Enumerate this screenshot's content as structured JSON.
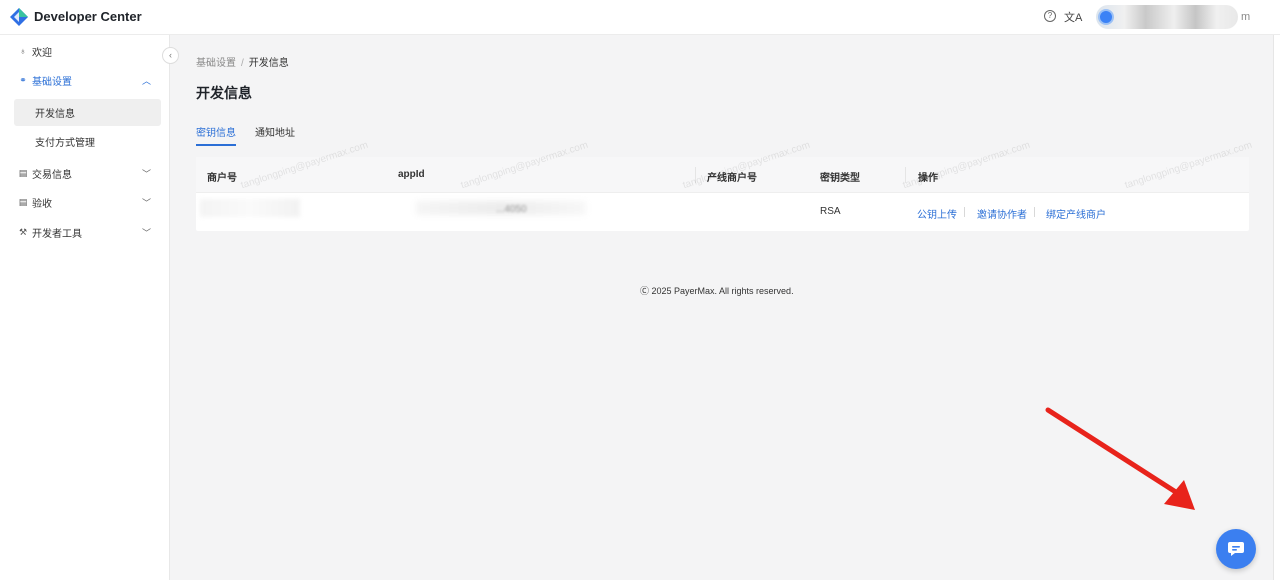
{
  "header": {
    "app_title": "Developer Center",
    "user_name_suffix": "m",
    "help_icon": "question-circle-icon",
    "language_icon": "translate-icon"
  },
  "sidebar": {
    "items": [
      {
        "label": "欢迎",
        "icon": "bulb-icon"
      },
      {
        "label": "基础设置",
        "icon": "link-icon",
        "expanded": true
      },
      {
        "label": "交易信息",
        "icon": "document-icon"
      },
      {
        "label": "验收",
        "icon": "document-icon"
      },
      {
        "label": "开发者工具",
        "icon": "wrench-icon"
      }
    ],
    "sub_items": [
      {
        "label": "开发信息",
        "selected": true
      },
      {
        "label": "支付方式管理"
      }
    ]
  },
  "breadcrumb": {
    "parent": "基础设置",
    "separator": "/",
    "current": "开发信息"
  },
  "page": {
    "title": "开发信息"
  },
  "tabs": [
    {
      "label": "密钥信息",
      "active": true
    },
    {
      "label": "通知地址"
    }
  ],
  "table": {
    "columns": [
      "商户号",
      "appId",
      "产线商户号",
      "密钥类型",
      "操作"
    ],
    "rows": [
      {
        "key_type": "RSA",
        "partial_app_id": "...4050",
        "actions": [
          "公钥上传",
          "邀请协作者",
          "绑定产线商户"
        ]
      }
    ]
  },
  "watermark": "tanglongping@payermax.com",
  "footer": "Ⓒ 2025 PayerMax. All rights reserved.",
  "colors": {
    "accent": "#2b6fd6",
    "arrow": "#e8231b",
    "chat": "#3b7ff0"
  }
}
